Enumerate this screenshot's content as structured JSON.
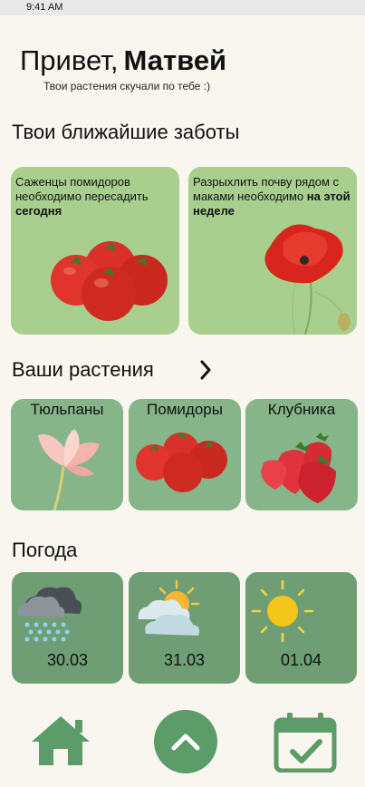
{
  "status_bar": {
    "time": "9:41 AM"
  },
  "header": {
    "greeting": "Привет,",
    "user_name": "Матвей",
    "subtitle": "Твои растения скучали по тебе :)"
  },
  "tasks_section": {
    "title": "Твои ближайшие заботы",
    "cards": [
      {
        "text": "Саженцы помидоров необходимо пересадить",
        "emphasis": "сегодня",
        "image": "tomatoes"
      },
      {
        "text": "Разрыхлить почву рядом с маками необходимо",
        "emphasis": "на этой неделе",
        "image": "poppy"
      }
    ]
  },
  "plants_section": {
    "title": "Ваши растения",
    "items": [
      {
        "label": "Тюльпаны",
        "image": "tulip"
      },
      {
        "label": "Помидоры",
        "image": "tomatoes"
      },
      {
        "label": "Клубника",
        "image": "strawberries"
      }
    ]
  },
  "weather_section": {
    "title": "Погода",
    "days": [
      {
        "date": "30.03",
        "icon": "rain-cloud-icon"
      },
      {
        "date": "31.03",
        "icon": "partly-cloudy-icon"
      },
      {
        "date": "01.04",
        "icon": "sun-icon"
      }
    ]
  },
  "bottom_nav": {
    "home_icon": "home-icon",
    "center_icon": "chevron-up-icon",
    "calendar_icon": "calendar-check-icon"
  },
  "colors": {
    "background": "#f8f6ef",
    "task_card": "#a9cf8e",
    "plant_card": "#85b589",
    "weather_card": "#6f9e75",
    "accent_green": "#5c9c68"
  }
}
